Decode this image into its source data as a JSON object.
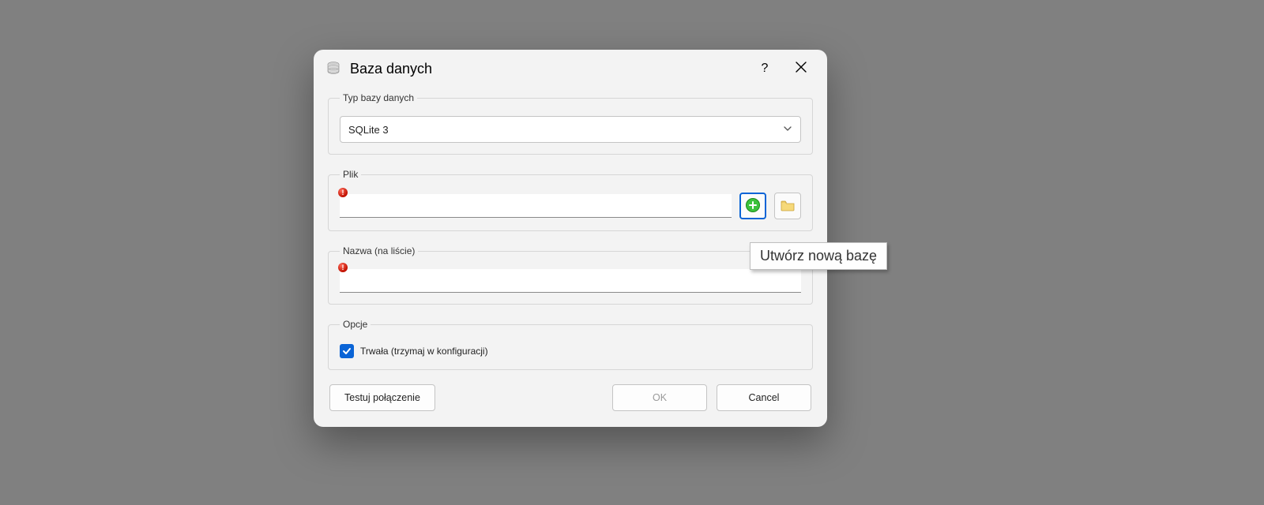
{
  "dialog": {
    "title": "Baza danych"
  },
  "groups": {
    "dbtype": {
      "legend": "Typ bazy danych",
      "selected": "SQLite 3"
    },
    "file": {
      "legend": "Plik",
      "value": ""
    },
    "name": {
      "legend": "Nazwa (na liście)",
      "value": ""
    },
    "options": {
      "legend": "Opcje",
      "persistent_label": "Trwała (trzymaj w konfiguracji)",
      "persistent_checked": true
    }
  },
  "buttons": {
    "test": "Testuj połączenie",
    "ok": "OK",
    "cancel": "Cancel"
  },
  "tooltip": "Utwórz nową bazę"
}
